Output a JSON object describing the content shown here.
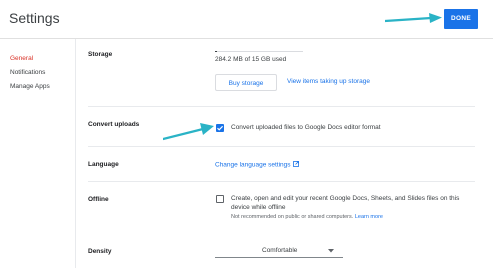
{
  "header": {
    "title": "Settings",
    "done_label": "DONE"
  },
  "sidebar": {
    "items": [
      {
        "label": "General",
        "active": true
      },
      {
        "label": "Notifications",
        "active": false
      },
      {
        "label": "Manage Apps",
        "active": false
      }
    ]
  },
  "storage": {
    "label": "Storage",
    "usage_text": "284.2 MB of 15 GB used",
    "used_fraction": 0.0185,
    "buy_label": "Buy storage",
    "view_label": "View items taking up storage"
  },
  "convert": {
    "label": "Convert uploads",
    "checked": true,
    "text": "Convert uploaded files to Google Docs editor format"
  },
  "language": {
    "label": "Language",
    "link_text": "Change language settings"
  },
  "offline": {
    "label": "Offline",
    "checked": false,
    "text_line1": "Create, open and edit your recent Google Docs, Sheets, and Slides files on this",
    "text_line2": "device while offline",
    "note": "Not recommended on public or shared computers.",
    "learn_more": "Learn more"
  },
  "density": {
    "label": "Density",
    "selected": "Comfortable"
  },
  "colors": {
    "accent": "#1a73e8",
    "active_nav": "#d93025",
    "annotation_arrow": "#2ab3c6"
  },
  "annotations": {
    "arrow_icon": "arrow-right-icon"
  }
}
